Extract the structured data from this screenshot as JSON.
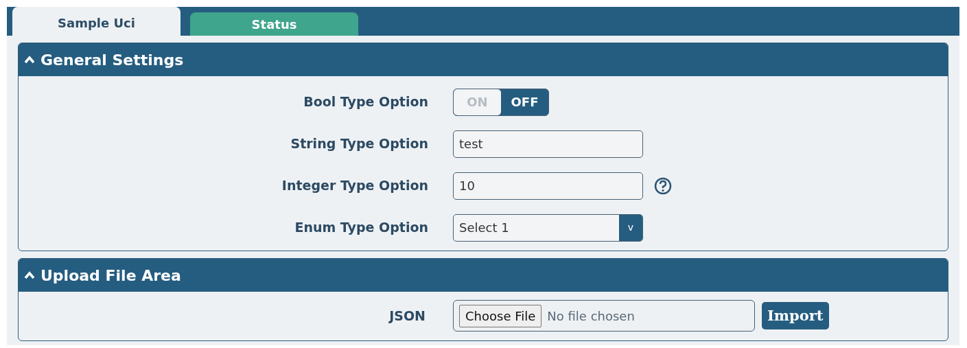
{
  "tabs": [
    {
      "label": "Sample Uci",
      "selected": true
    },
    {
      "label": "Status",
      "selected": false
    }
  ],
  "sections": [
    {
      "title": "General Settings",
      "expanded": true,
      "fields": [
        {
          "kind": "toggle",
          "label": "Bool Type Option",
          "on_text": "ON",
          "off_text": "OFF",
          "on": false
        },
        {
          "kind": "text",
          "label": "String Type Option",
          "value": "test",
          "help": false
        },
        {
          "kind": "text",
          "label": "Integer Type Option",
          "value": "10",
          "help": true
        },
        {
          "kind": "select",
          "label": "Enum Type Option",
          "value": "Select 1",
          "caret": "v"
        }
      ]
    },
    {
      "title": "Upload File Area",
      "expanded": true,
      "fields": [
        {
          "kind": "file",
          "label": "JSON",
          "button": "Choose File",
          "status": "No file chosen",
          "action": "Import"
        }
      ]
    }
  ]
}
